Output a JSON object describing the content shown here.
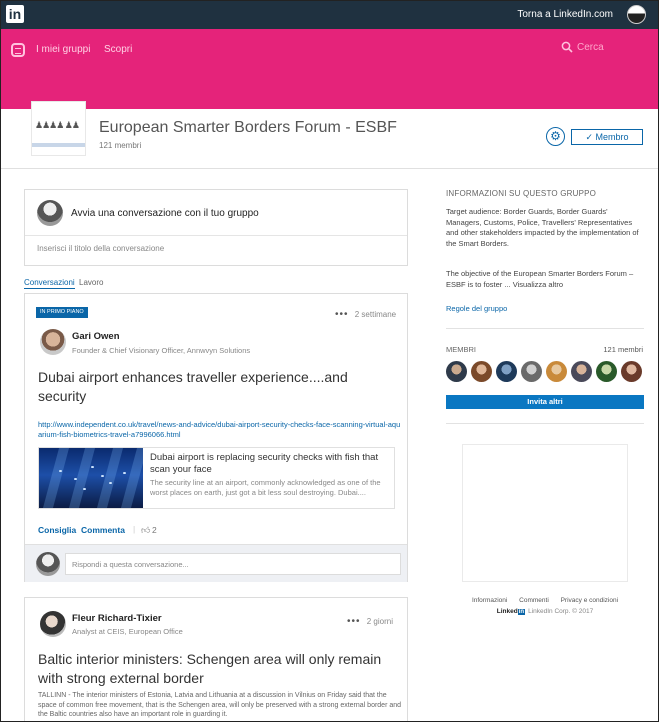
{
  "topbar": {
    "logo": "in",
    "back_link": "Torna a LinkedIn.com"
  },
  "nav": {
    "my_groups": "I miei gruppi",
    "discover": "Scopri",
    "search_placeholder": "Cerca"
  },
  "group": {
    "title": "European Smarter Borders Forum - ESBF",
    "member_count": "121 membri",
    "member_button": "✓ Membro"
  },
  "compose": {
    "prompt": "Avvia una conversazione con il tuo gruppo",
    "title_placeholder": "Inserisci il titolo della conversazione"
  },
  "tabs": {
    "conversations": "Conversazioni",
    "work": "Lavoro"
  },
  "post1": {
    "badge": "IN PRIMO PIANO",
    "menu_dots": "•••",
    "time": "2 settimane",
    "author_name": "Gari Owen",
    "author_role": "Founder & Chief Visionary Officer, Annwvyn Solutions",
    "title": "Dubai airport enhances traveller experience....and security",
    "url": "http://www.independent.co.uk/travel/news-and-advice/dubai-airport-security-checks-face-scanning-virtual-aquarium-fish-biometrics-travel-a7996066.html",
    "preview_title": "Dubai airport is replacing security checks with fish that scan your face",
    "preview_desc": "The security line at an airport, commonly acknowledged as one of the worst places on earth, just got a bit less soul destroying. Dubai....",
    "like_label": "Consiglia",
    "comment_label": "Commenta",
    "separator": "|",
    "like_count": "2",
    "reply_placeholder": "Rispondi a questa conversazione..."
  },
  "post2": {
    "menu_dots": "•••",
    "time": "2 giorni",
    "author_name": "Fleur Richard-Tixier",
    "author_role": "Analyst at CEIS, European Office",
    "title": "Baltic interior ministers: Schengen area will only remain with strong external border",
    "body": "TALLINN - The interior ministers of Estonia, Latvia and Lithuania at a discussion in Vilnius on Friday said that the space of common free movement, that is the Schengen area, will only be preserved with a strong external border and the Baltic countries also have an important role in guarding it."
  },
  "sidebar": {
    "about_heading": "INFORMAZIONI SU QUESTO GRUPPO",
    "about_text": "Target audience: Border Guards, Border Guards' Managers, Customs, Police, Travellers' Representatives and other stakeholders impacted by the implementation of the Smart Borders.",
    "about_text2": "The objective of the European Smarter Borders Forum – ESBF is to foster ...",
    "show_more": "Visualizza altro",
    "rules_link": "Regole del gruppo",
    "members_heading": "MEMBRI",
    "members_count": "121 membri",
    "invite_button": "Invita altri"
  },
  "footer": {
    "info": "Informazioni",
    "comments": "Commenti",
    "privacy": "Privacy e condizioni",
    "brand_text": "Linked",
    "brand_in": "in",
    "copyright": "LinkedIn Corp. © 2017"
  },
  "colors": {
    "topbar": "#1f3140",
    "brand_pink": "#e5237a",
    "link_blue": "#0a66a8",
    "invite_blue": "#0a77c2"
  },
  "icons": {
    "group_nav": "group-chat-icon",
    "search": "search-icon",
    "settings": "gear-icon",
    "like": "thumbs-up-icon"
  }
}
